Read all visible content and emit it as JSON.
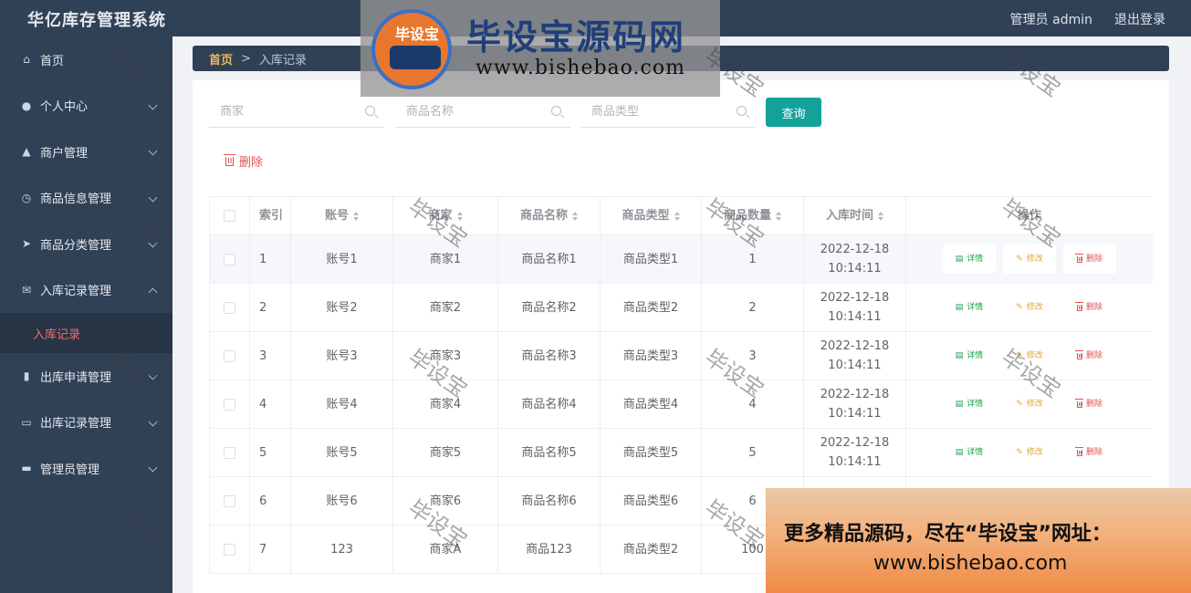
{
  "app": {
    "title": "华亿库存管理系统",
    "user": "管理员 admin",
    "logout": "退出登录"
  },
  "sidebar": {
    "items": [
      {
        "label": "首页",
        "icon": "home-icon"
      },
      {
        "label": "个人中心",
        "icon": "user-icon"
      },
      {
        "label": "商户管理",
        "icon": "merchant-icon"
      },
      {
        "label": "商品信息管理",
        "icon": "clock-icon"
      },
      {
        "label": "商品分类管理",
        "icon": "send-icon"
      },
      {
        "label": "入库记录管理",
        "icon": "mail-icon",
        "expanded": true
      },
      {
        "label": "出库申请管理",
        "icon": "chart-icon"
      },
      {
        "label": "出库记录管理",
        "icon": "chat-icon"
      },
      {
        "label": "管理员管理",
        "icon": "monitor-icon"
      }
    ],
    "subitem": "入库记录"
  },
  "breadcrumb": {
    "home": "首页",
    "separator": ">",
    "current": "入库记录"
  },
  "search": {
    "merchant_placeholder": "商家",
    "name_placeholder": "商品名称",
    "type_placeholder": "商品类型",
    "query_label": "查询"
  },
  "actions": {
    "delete_label": "删除"
  },
  "table": {
    "headers": {
      "index": "索引",
      "account": "账号",
      "merchant": "商家",
      "name": "商品名称",
      "type": "商品类型",
      "quantity": "商品数量",
      "time": "入库时间",
      "ops": "操作"
    },
    "op_labels": {
      "detail": "详情",
      "edit": "修改",
      "delete": "删除"
    },
    "rows": [
      {
        "index": "1",
        "account": "账号1",
        "merchant": "商家1",
        "name": "商品名称1",
        "type": "商品类型1",
        "quantity": "1",
        "time": "2022-12-18 10:14:11"
      },
      {
        "index": "2",
        "account": "账号2",
        "merchant": "商家2",
        "name": "商品名称2",
        "type": "商品类型2",
        "quantity": "2",
        "time": "2022-12-18 10:14:11"
      },
      {
        "index": "3",
        "account": "账号3",
        "merchant": "商家3",
        "name": "商品名称3",
        "type": "商品类型3",
        "quantity": "3",
        "time": "2022-12-18 10:14:11"
      },
      {
        "index": "4",
        "account": "账号4",
        "merchant": "商家4",
        "name": "商品名称4",
        "type": "商品类型4",
        "quantity": "4",
        "time": "2022-12-18 10:14:11"
      },
      {
        "index": "5",
        "account": "账号5",
        "merchant": "商家5",
        "name": "商品名称5",
        "type": "商品类型5",
        "quantity": "5",
        "time": "2022-12-18 10:14:11"
      },
      {
        "index": "6",
        "account": "账号6",
        "merchant": "商家6",
        "name": "商品名称6",
        "type": "商品类型6",
        "quantity": "6",
        "time": ""
      },
      {
        "index": "7",
        "account": "123",
        "merchant": "商家A",
        "name": "商品123",
        "type": "商品类型2",
        "quantity": "100",
        "time": ""
      }
    ]
  },
  "watermark": {
    "logo_text": "毕设宝",
    "title": "毕设宝源码网",
    "url": "www.bishebao.com",
    "stamp": "毕设宝",
    "ad_line1": "更多精品源码，尽在“毕设宝”网址：",
    "ad_line2": "www.bishebao.com"
  }
}
